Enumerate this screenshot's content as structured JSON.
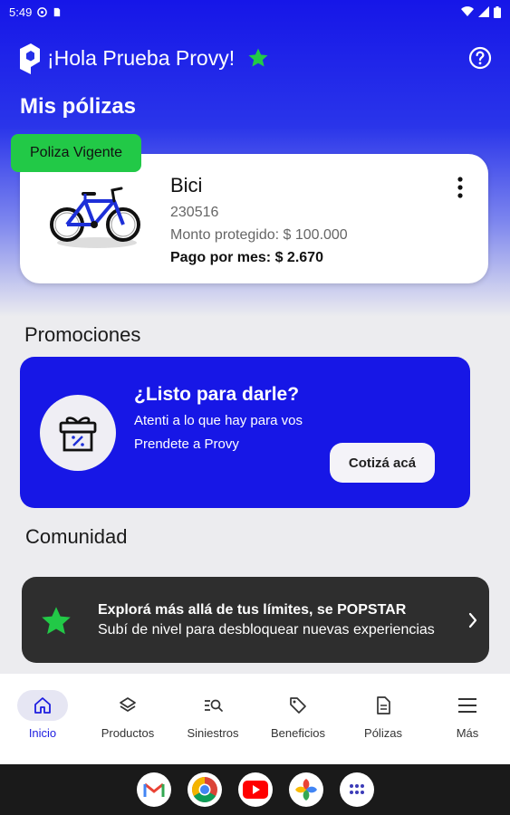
{
  "status_bar": {
    "time": "5:49"
  },
  "header": {
    "greeting": "¡Hola Prueba Provy!"
  },
  "policies": {
    "section_title": "Mis pólizas",
    "badge": "Poliza Vigente",
    "card": {
      "title": "Bici",
      "number": "230516",
      "coverage": "Monto protegido: $ 100.000",
      "monthly": "Pago por mes: $ 2.670"
    }
  },
  "promotions": {
    "section_title": "Promociones",
    "headline": "¿Listo para darle?",
    "line1": "Atenti a lo que hay para vos",
    "line2": "Prendete a Provy",
    "cta": "Cotizá acá"
  },
  "community": {
    "section_title": "Comunidad",
    "headline": "Explorá más allá de tus límites, se POPSTAR",
    "subtitle": "Subí de nivel para desbloquear nuevas experiencias"
  },
  "bottom_nav": {
    "items": [
      {
        "label": "Inicio",
        "icon": "home-icon",
        "active": true
      },
      {
        "label": "Productos",
        "icon": "layers-icon",
        "active": false
      },
      {
        "label": "Siniestros",
        "icon": "search-list-icon",
        "active": false
      },
      {
        "label": "Beneficios",
        "icon": "tag-icon",
        "active": false
      },
      {
        "label": "Pólizas",
        "icon": "document-icon",
        "active": false
      },
      {
        "label": "Más",
        "icon": "menu-icon",
        "active": false
      }
    ]
  },
  "system_dock": {
    "apps": [
      "gmail-icon",
      "chrome-icon",
      "youtube-icon",
      "photos-icon",
      "app-drawer-icon"
    ]
  },
  "colors": {
    "brand_blue": "#1717e6",
    "accent_green": "#22c947",
    "dark_card": "#2e2e2e"
  }
}
